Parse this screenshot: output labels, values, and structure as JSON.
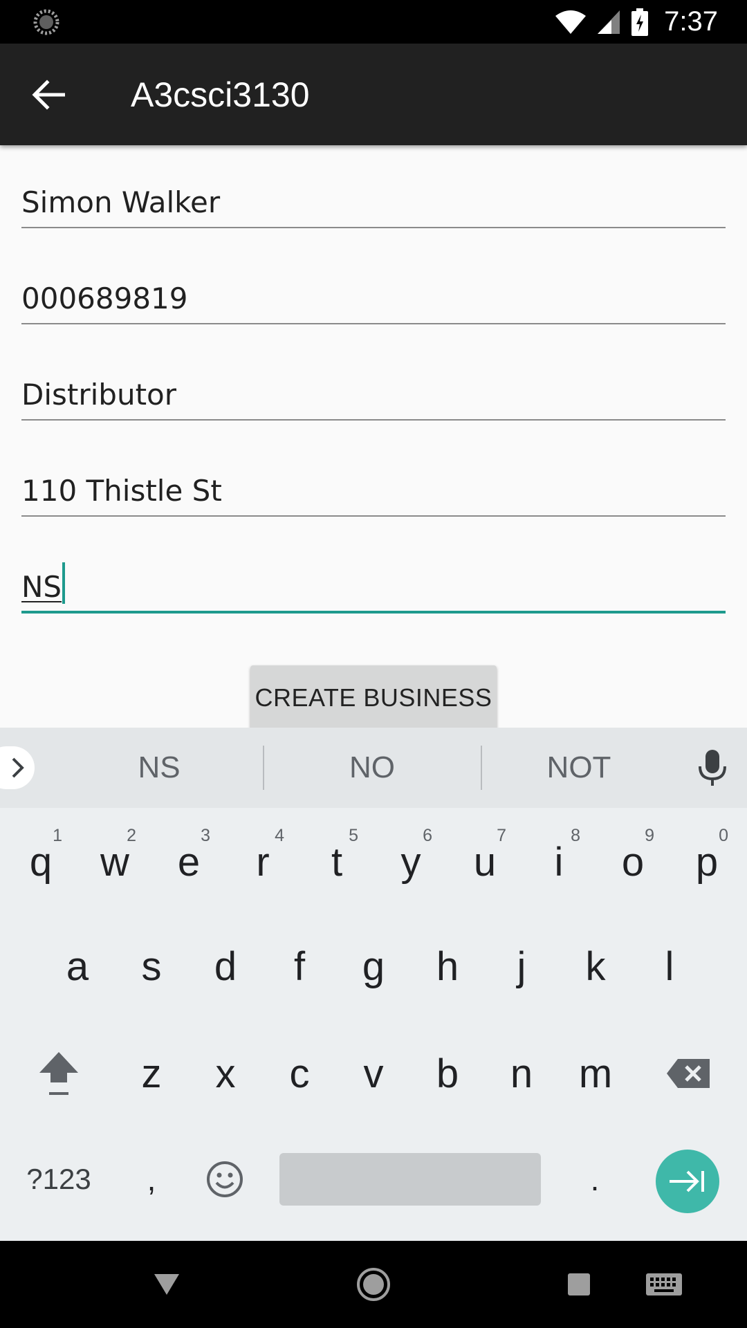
{
  "status_bar": {
    "time": "7:37"
  },
  "app_bar": {
    "title": "A3csci3130"
  },
  "form": {
    "fields": [
      {
        "value": "Simon Walker"
      },
      {
        "value": "000689819"
      },
      {
        "value": "Distributor"
      },
      {
        "value": "110 Thistle St"
      },
      {
        "value": "NS"
      }
    ],
    "create_button": "CREATE BUSINESS"
  },
  "keyboard": {
    "suggestions": [
      "NS",
      "NO",
      "NOT"
    ],
    "row1": [
      {
        "k": "q",
        "h": "1"
      },
      {
        "k": "w",
        "h": "2"
      },
      {
        "k": "e",
        "h": "3"
      },
      {
        "k": "r",
        "h": "4"
      },
      {
        "k": "t",
        "h": "5"
      },
      {
        "k": "y",
        "h": "6"
      },
      {
        "k": "u",
        "h": "7"
      },
      {
        "k": "i",
        "h": "8"
      },
      {
        "k": "o",
        "h": "9"
      },
      {
        "k": "p",
        "h": "0"
      }
    ],
    "row2": [
      "a",
      "s",
      "d",
      "f",
      "g",
      "h",
      "j",
      "k",
      "l"
    ],
    "row3": [
      "z",
      "x",
      "c",
      "v",
      "b",
      "n",
      "m"
    ],
    "symbols_key": "?123",
    "comma_key": ",",
    "period_key": "."
  }
}
